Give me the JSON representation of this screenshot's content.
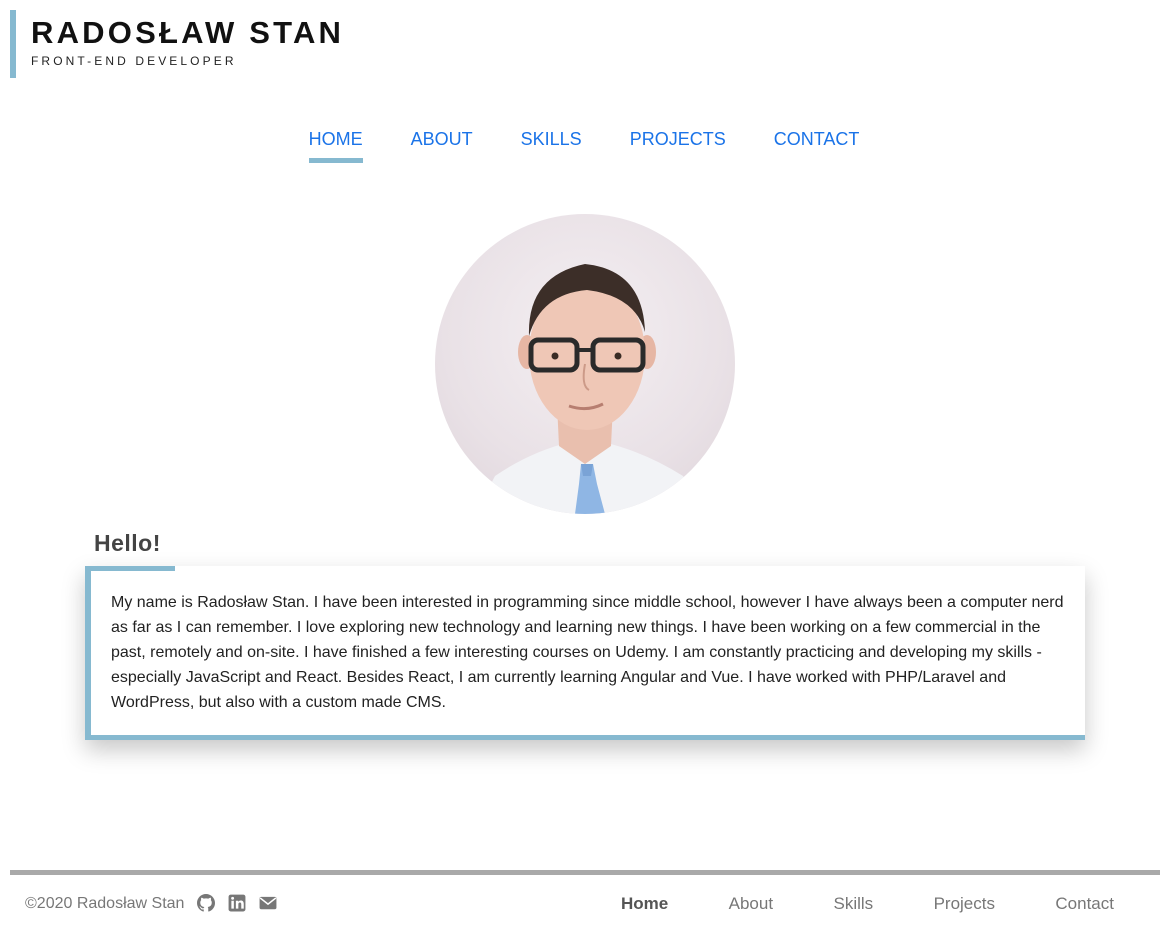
{
  "header": {
    "name": "RADOSŁAW STAN",
    "subtitle": "FRONT-END DEVELOPER"
  },
  "nav": {
    "items": [
      {
        "label": "HOME",
        "active": true
      },
      {
        "label": "ABOUT",
        "active": false
      },
      {
        "label": "SKILLS",
        "active": false
      },
      {
        "label": "PROJECTS",
        "active": false
      },
      {
        "label": "CONTACT",
        "active": false
      }
    ]
  },
  "hero": {
    "heading": "Hello!",
    "bio": "My name is Radosław Stan. I have been interested in programming since middle school, however I have always been a computer nerd as far as I can remember. I love exploring new technology and learning new things. I have been working on a few commercial in the past, remotely and on-site. I have finished a few interesting courses on Udemy. I am constantly practicing and developing my skills - especially JavaScript and React. Besides React, I am currently learning Angular and Vue. I have worked with PHP/Laravel and WordPress, but also with a custom made CMS."
  },
  "footer": {
    "copyright": "©2020 Radosław Stan",
    "icons": [
      "github-icon",
      "linkedin-icon",
      "envelope-icon"
    ],
    "links": [
      {
        "label": "Home",
        "active": true
      },
      {
        "label": "About",
        "active": false
      },
      {
        "label": "Skills",
        "active": false
      },
      {
        "label": "Projects",
        "active": false
      },
      {
        "label": "Contact",
        "active": false
      }
    ]
  },
  "colors": {
    "accent": "#86b9d0",
    "nav_link": "#1a73e8",
    "footer_rule": "#a9a9a9",
    "footer_text": "#777777"
  }
}
